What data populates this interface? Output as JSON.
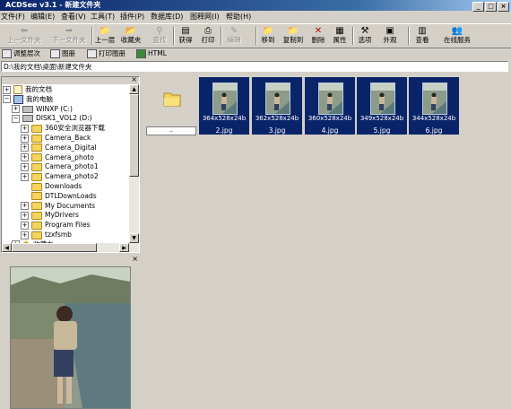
{
  "window": {
    "title": "ACDSee v3.1 - 新建文件夹",
    "controls": [
      "_",
      "□",
      "×"
    ]
  },
  "menu": [
    "文件(F)",
    "编辑(E)",
    "查看(V)",
    "工具(T)",
    "插件(P)",
    "数据库(D)",
    "图释网(I)",
    "帮助(H)"
  ],
  "toolbar": {
    "up_folder": "上一文件夹",
    "next_folder": "下一文件夹",
    "up_level": "上一层",
    "favorites": "收藏夹",
    "find": "查找",
    "acquire": "获得",
    "print": "打印",
    "edit": "编辑",
    "move_to": "移到",
    "copy_to": "复制到",
    "delete": "删除",
    "properties": "属性",
    "options": "选项",
    "appearance": "外观",
    "view": "查看",
    "online": "在线服务"
  },
  "toolbar2": {
    "adjust_levels": "调整层次",
    "photo_album": "图册",
    "print_album": "打印图册",
    "html": "HTML"
  },
  "address": "D:\\我的文档\\桌面\\新建文件夹",
  "tree": [
    {
      "label": "我的文档",
      "kind": "doc",
      "exp": "+"
    },
    {
      "label": "我的电脑",
      "kind": "pc",
      "exp": "−"
    },
    {
      "label": "WINXP (C:)",
      "kind": "drive",
      "exp": "+"
    },
    {
      "label": "DISK1_VOL2 (D:)",
      "kind": "drive",
      "exp": "−"
    },
    {
      "label": "360安全浏览器下载",
      "kind": "folder",
      "exp": "+"
    },
    {
      "label": "Camera_Back",
      "kind": "folder",
      "exp": "+"
    },
    {
      "label": "Camera_Digital",
      "kind": "folder",
      "exp": "+"
    },
    {
      "label": "Camera_photo",
      "kind": "folder",
      "exp": "+"
    },
    {
      "label": "Camera_photo1",
      "kind": "folder",
      "exp": "+"
    },
    {
      "label": "Camera_photo2",
      "kind": "folder",
      "exp": "+"
    },
    {
      "label": "Downloads",
      "kind": "folder",
      "exp": ""
    },
    {
      "label": "DTLDownLoads",
      "kind": "folder",
      "exp": ""
    },
    {
      "label": "My Documents",
      "kind": "folder",
      "exp": "+"
    },
    {
      "label": "MyDrivers",
      "kind": "folder",
      "exp": "+"
    },
    {
      "label": "Program Files",
      "kind": "folder",
      "exp": "+"
    },
    {
      "label": "tzxfsmb",
      "kind": "folder",
      "exp": "+"
    },
    {
      "label": "收藏夹",
      "kind": "star",
      "exp": "+"
    }
  ],
  "parent_tile": {
    "label": "..",
    "icon": "folder-icon"
  },
  "files": [
    {
      "name": "2.jpg",
      "dims": "364x528x24b"
    },
    {
      "name": "3.jpg",
      "dims": "362x528x24b"
    },
    {
      "name": "4.jpg",
      "dims": "360x528x24b"
    },
    {
      "name": "5.jpg",
      "dims": "349x528x24b"
    },
    {
      "name": "6.jpg",
      "dims": "344x528x24b"
    }
  ],
  "colors": {
    "selection": "#0a246a",
    "face": "#d4d0c8",
    "titlebar": "#0a246a"
  }
}
